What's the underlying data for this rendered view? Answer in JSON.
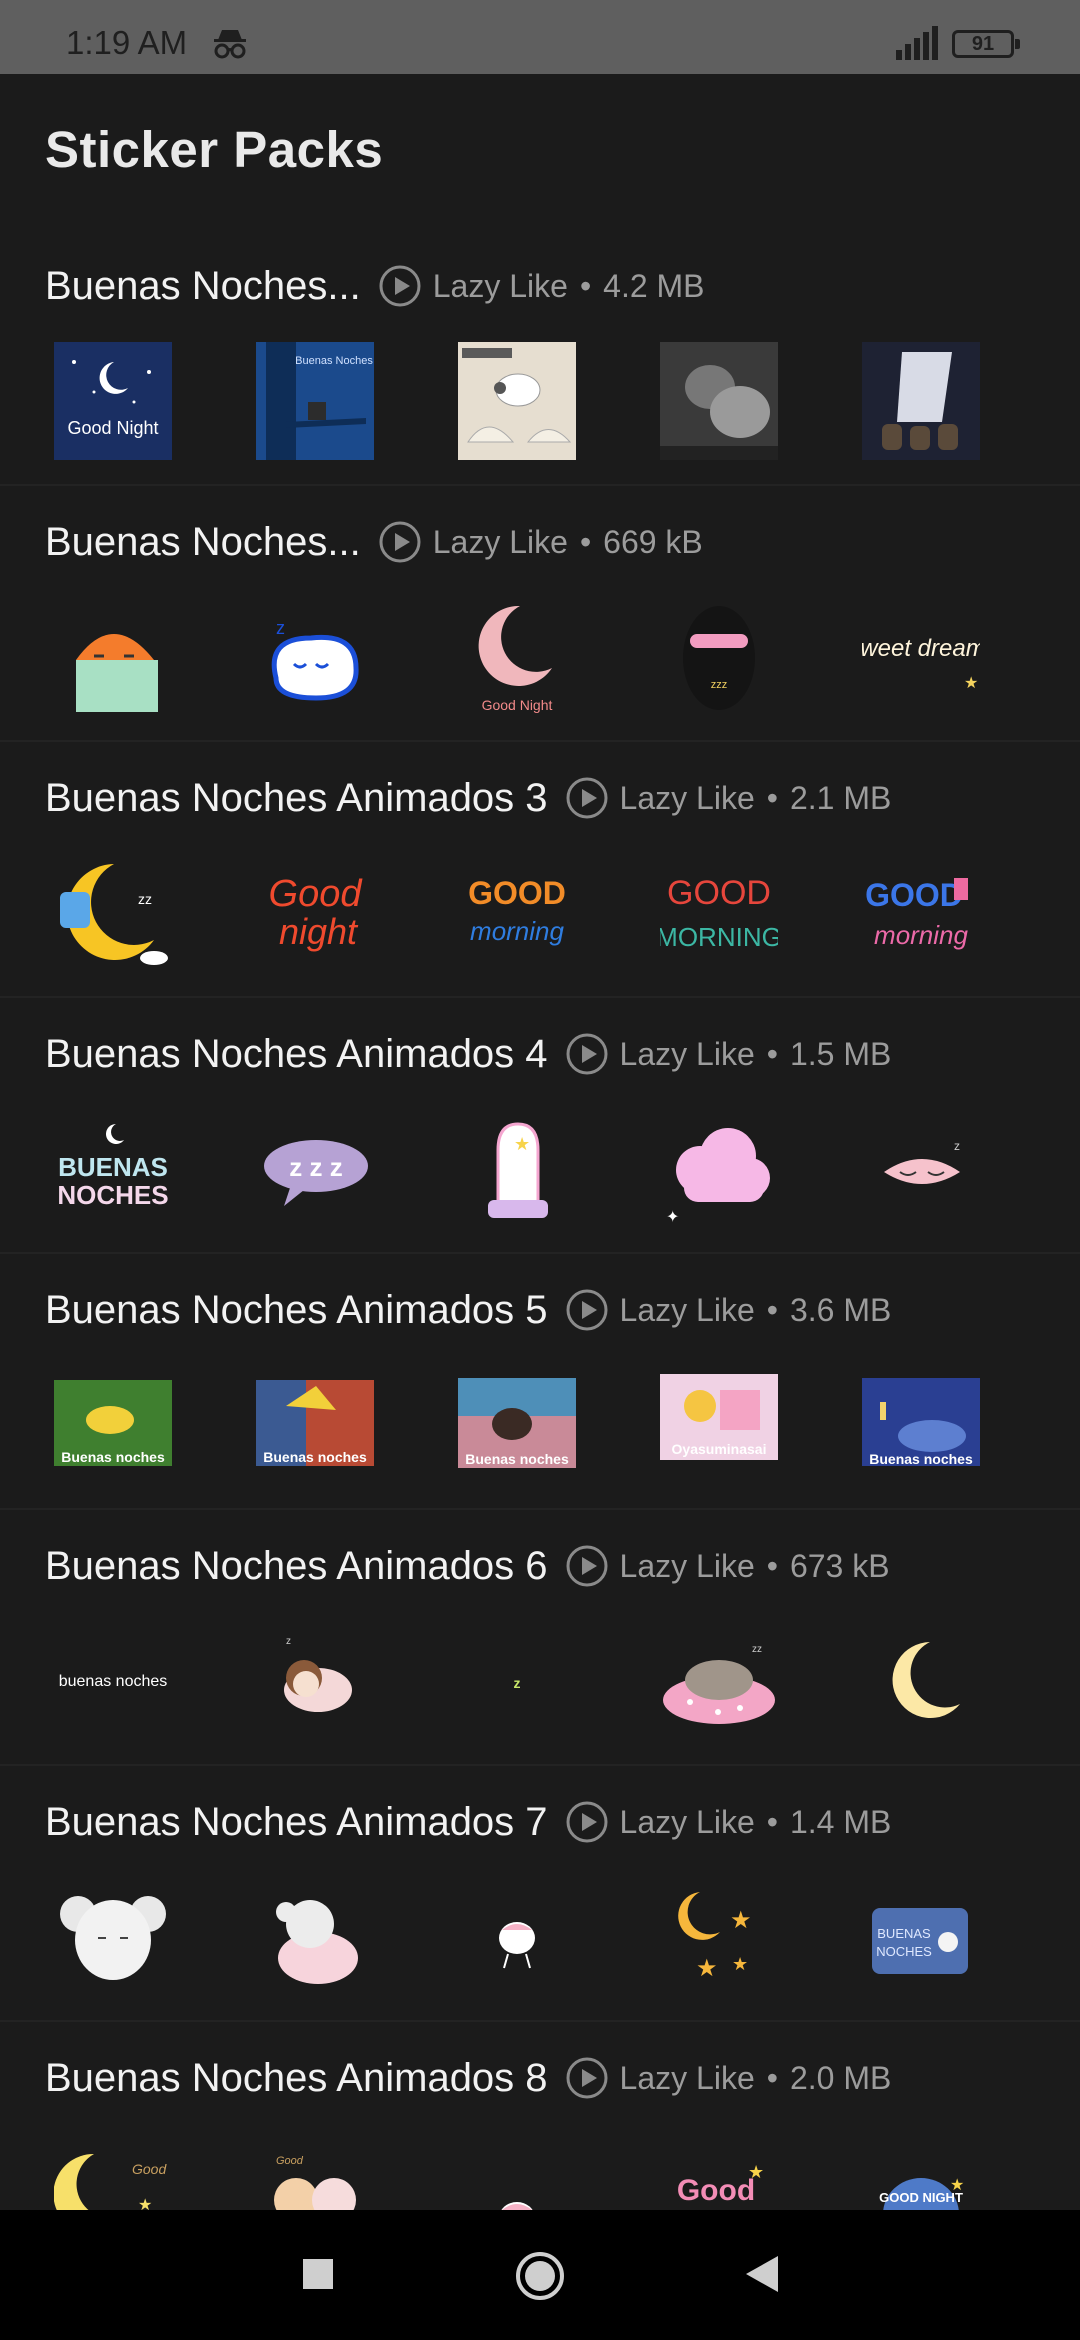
{
  "status_bar": {
    "time": "1:19 AM",
    "battery": "91"
  },
  "page": {
    "title": "Sticker Packs"
  },
  "packs": [
    {
      "name": "Buenas Noches...",
      "publisher": "Lazy Like",
      "size": "4.2 MB"
    },
    {
      "name": "Buenas Noches...",
      "publisher": "Lazy Like",
      "size": "669 kB"
    },
    {
      "name": "Buenas Noches Animados 3",
      "publisher": "Lazy Like",
      "size": "2.1 MB"
    },
    {
      "name": "Buenas Noches Animados 4",
      "publisher": "Lazy Like",
      "size": "1.5 MB"
    },
    {
      "name": "Buenas Noches Animados 5",
      "publisher": "Lazy Like",
      "size": "3.6 MB"
    },
    {
      "name": "Buenas Noches Animados 6",
      "publisher": "Lazy Like",
      "size": "673 kB"
    },
    {
      "name": "Buenas Noches Animados 7",
      "publisher": "Lazy Like",
      "size": "1.4 MB"
    },
    {
      "name": "Buenas Noches Animados 8",
      "publisher": "Lazy Like",
      "size": "2.0 MB"
    }
  ],
  "sticker_text": {
    "good_night": "Good Night",
    "buenas_noches_book": "Buenas Noches",
    "good_night_small": "Good Night",
    "sweet_dreams": "Sweet dreams",
    "good": "Good",
    "night": "night",
    "good_caps": "GOOD",
    "morning": "morning",
    "morning_caps": "MORNING",
    "buenas": "BUENAS",
    "noches": "NOCHES",
    "zzz": "z z z",
    "buenas_noches": "Buenas noches",
    "oyasuminasai": "Oyasuminasai",
    "buenas_noches_lower": "buenas noches",
    "buenas_caps": "BUENAS",
    "noches_caps": "NOCHES",
    "good_night_caps": "GOOD NIGHT"
  },
  "icons": {
    "incognito": "incognito-icon",
    "signal": "signal-icon",
    "play": "play-circle-icon",
    "nav_recent": "square-icon",
    "nav_home": "circle-icon",
    "nav_back": "triangle-back-icon"
  }
}
